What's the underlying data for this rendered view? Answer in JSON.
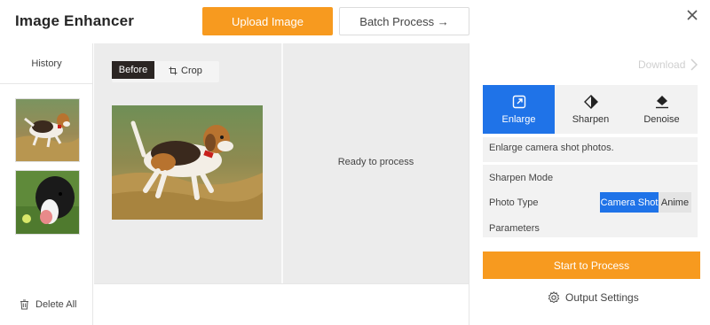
{
  "header": {
    "title": "Image Enhancer",
    "upload_label": "Upload Image",
    "batch_label": "Batch Process →"
  },
  "history": {
    "label": "History",
    "delete_all_label": "Delete All"
  },
  "preview": {
    "before_label": "Before",
    "crop_label": "Crop",
    "ready_text": "Ready to process"
  },
  "panel": {
    "download_label": "Download",
    "tabs": [
      {
        "label": "Enlarge",
        "icon": "enlarge-icon",
        "active": true
      },
      {
        "label": "Sharpen",
        "icon": "sharpen-icon",
        "active": false
      },
      {
        "label": "Denoise",
        "icon": "denoise-icon",
        "active": false
      }
    ],
    "description": "Enlarge camera shot photos.",
    "sharpen_mode_label": "Sharpen Mode",
    "photo_type_label": "Photo Type",
    "photo_type_options": [
      "Camera Shot",
      "Anime"
    ],
    "photo_type_selected": "Camera Shot",
    "parameters_label": "Parameters",
    "start_label": "Start to Process",
    "output_settings_label": "Output Settings"
  },
  "colors": {
    "accent_orange": "#f79a1f",
    "accent_blue": "#1f73e8",
    "pane_gray": "#ececec"
  }
}
